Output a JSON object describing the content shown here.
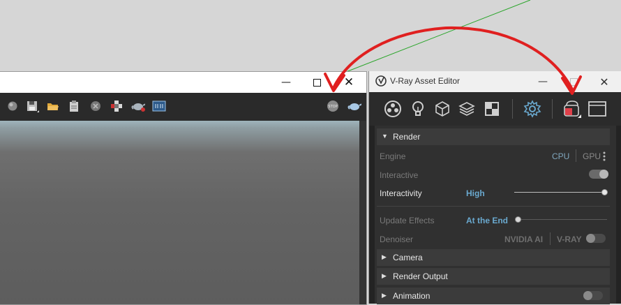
{
  "vfb": {
    "toolbar_icons": [
      "sphere-icon",
      "save-icon",
      "folder-icon",
      "clipboard-icon",
      "clear-icon",
      "region-icon",
      "teapot-render-icon",
      "vfb-history-icon",
      "stop-icon",
      "teapot-icon"
    ]
  },
  "asset_editor": {
    "title": "V-Ray Asset Editor",
    "tabs": [
      "materials-icon",
      "lights-icon",
      "geometry-icon",
      "render-elements-icon",
      "textures-icon",
      "settings-icon",
      "render-interactive-icon",
      "frame-buffer-icon"
    ],
    "render": {
      "label": "Render",
      "engine_label": "Engine",
      "engine_cpu": "CPU",
      "engine_gpu": "GPU",
      "interactive_label": "Interactive",
      "interactive_on": true,
      "interactivity_label": "Interactivity",
      "interactivity_value": "High",
      "interactivity_level": 1.0,
      "update_effects_label": "Update Effects",
      "update_effects_value": "At the End",
      "update_effects_level": 0.0,
      "denoiser_label": "Denoiser",
      "denoiser_nvidia": "NVIDIA AI",
      "denoiser_vray": "V-RAY",
      "denoiser_on": false
    },
    "sections": {
      "camera": "Camera",
      "render_output": "Render Output",
      "animation": "Animation"
    },
    "animation_on": false
  },
  "colors": {
    "arrow": "#e02020",
    "accent_blue": "#6aa9cf",
    "panel_bg": "#303030"
  }
}
